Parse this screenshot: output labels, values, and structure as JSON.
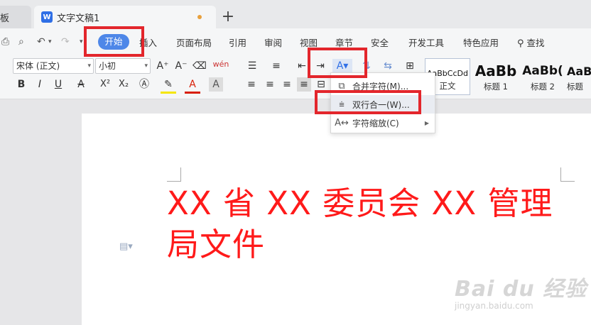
{
  "tabs": {
    "prev_label": "板",
    "active": {
      "icon_letter": "W",
      "title": "文字文稿1"
    },
    "new_tab": "+"
  },
  "menu": {
    "items": [
      "开始",
      "插入",
      "页面布局",
      "引用",
      "审阅",
      "视图",
      "章节",
      "安全",
      "开发工具",
      "特色应用"
    ],
    "search_label": "查找"
  },
  "ribbon": {
    "font_name": "宋体 (正文)",
    "font_size": "小初",
    "grow_font": "A⁺",
    "shrink_font": "A⁻",
    "bold": "B",
    "italic": "I",
    "underline": "U",
    "strike": "A",
    "superscript": "X²",
    "subscript": "X₂",
    "styles": [
      {
        "preview": "AaBbCcDd",
        "label": "正文"
      },
      {
        "preview": "AaBb",
        "label": "标题 1"
      },
      {
        "preview": "AaBb(",
        "label": "标题 2"
      },
      {
        "preview": "AaB",
        "label": "标题"
      }
    ]
  },
  "popup": {
    "items": [
      {
        "label": "合并字符(M)...",
        "icon": "merge-chars-icon"
      },
      {
        "label": "双行合一(W)...",
        "icon": "two-lines-icon"
      },
      {
        "label": "字符缩放(C)",
        "icon": "char-scale-icon"
      }
    ]
  },
  "document": {
    "text": "XX 省 XX 委员会 XX 管理局文件",
    "text_color": "#ff1a1a"
  },
  "watermark": {
    "logo": "Bai du 经验",
    "url": "jingyan.baidu.com"
  },
  "colors": {
    "accent": "#4e87e8",
    "highlight": "#e3262c"
  }
}
